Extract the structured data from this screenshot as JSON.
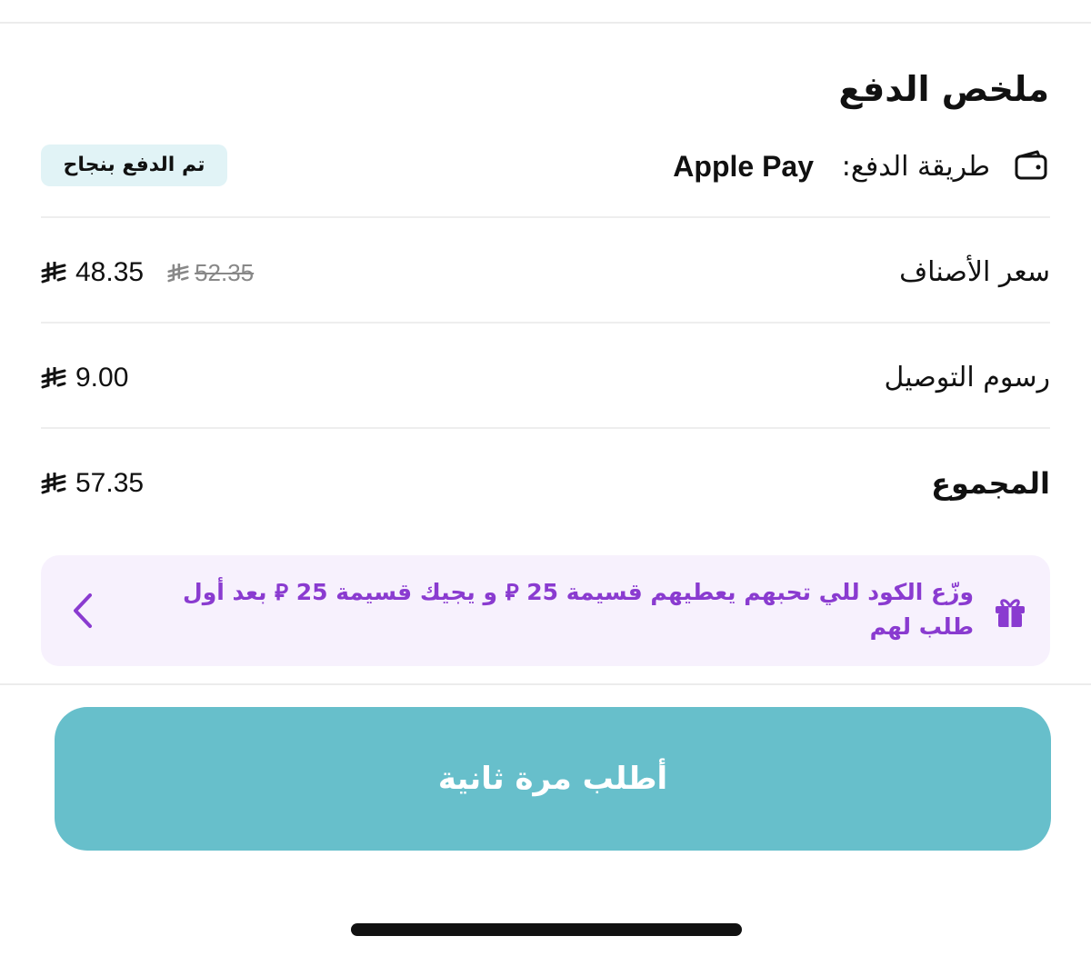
{
  "summary": {
    "title": "ملخص الدفع",
    "payment_method_label": "طريقة الدفع:",
    "payment_method_value": "Apple Pay",
    "status_badge": "تم الدفع بنجاح"
  },
  "rows": [
    {
      "label": "سعر الأصناف",
      "amount": "48.35",
      "old_amount": "52.35"
    },
    {
      "label": "رسوم التوصيل",
      "amount": "9.00"
    },
    {
      "label": "المجموع",
      "amount": "57.35"
    }
  ],
  "promo": {
    "text": "وزّع الكود للي تحبهم يعطيهم قسيمة 25 ⃁ و يجيك قسيمة 25 ⃁ بعد أول طلب لهم",
    "text_color": "#8a3bd0",
    "background": "#f7f1fd",
    "icon": "gift-icon"
  },
  "actions": {
    "reorder_label": "أطلب مرة ثانية",
    "reorder_color": "#67bfcb"
  },
  "icons": {
    "wallet": "wallet-icon",
    "currency": "riyal-sign-icon",
    "chevron": "chevron-left-icon"
  }
}
